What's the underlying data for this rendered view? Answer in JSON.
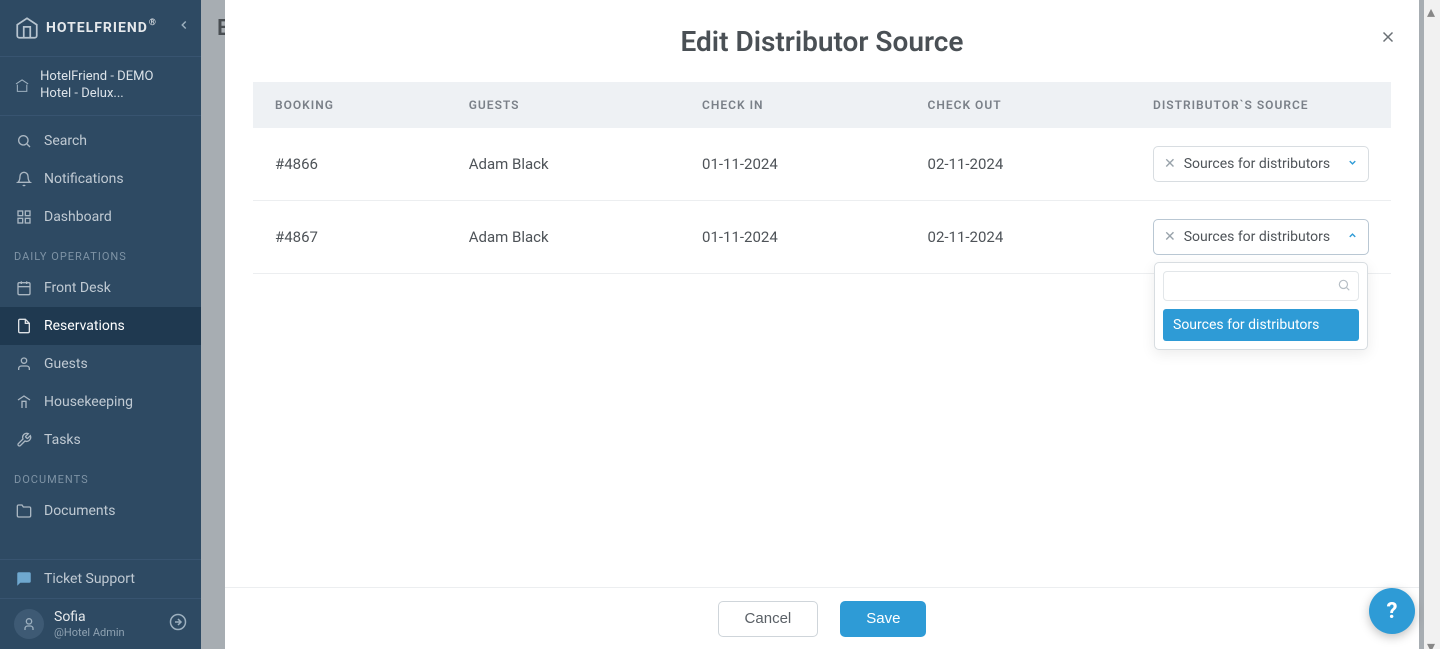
{
  "brand": "HOTELFRIEND",
  "hotel_name": "HotelFriend - DEMO Hotel - Delux...",
  "sidebar": {
    "search": "Search",
    "notifications": "Notifications",
    "dashboard": "Dashboard",
    "sections": {
      "daily_ops": "DAILY OPERATIONS",
      "documents": "DOCUMENTS"
    },
    "items": {
      "front_desk": "Front Desk",
      "reservations": "Reservations",
      "guests": "Guests",
      "housekeeping": "Housekeeping",
      "tasks": "Tasks",
      "documents": "Documents"
    },
    "ticket_support": "Ticket Support",
    "user": {
      "name": "Sofia",
      "role": "@Hotel Admin"
    }
  },
  "background_page_letter": "E",
  "modal": {
    "title": "Edit Distributor Source",
    "columns": {
      "booking": "BOOKING",
      "guests": "GUESTS",
      "check_in": "CHECK IN",
      "check_out": "CHECK OUT",
      "dist_source": "DISTRIBUTOR`S SOURCE"
    },
    "rows": [
      {
        "booking": "#4866",
        "guest": "Adam Black",
        "check_in": "01-11-2024",
        "check_out": "02-11-2024",
        "source": "Sources for distributors"
      },
      {
        "booking": "#4867",
        "guest": "Adam Black",
        "check_in": "01-11-2024",
        "check_out": "02-11-2024",
        "source": "Sources for distributors"
      }
    ],
    "dropdown": {
      "search_placeholder": "",
      "option": "Sources for distributors"
    },
    "buttons": {
      "cancel": "Cancel",
      "save": "Save"
    }
  },
  "help_fab": "?"
}
